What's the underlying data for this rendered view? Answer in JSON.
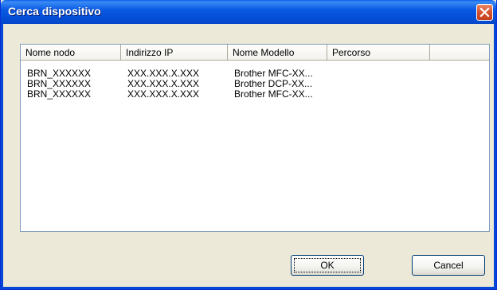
{
  "window": {
    "title": "Cerca dispositivo"
  },
  "table": {
    "columns": [
      "Nome nodo",
      "Indirizzo IP",
      "Nome Modello",
      "Percorso"
    ],
    "rows": [
      {
        "node": "BRN_XXXXXX",
        "ip": "XXX.XXX.X.XXX",
        "model": "Brother MFC-XX...",
        "path": ""
      },
      {
        "node": "BRN_XXXXXX",
        "ip": "XXX.XXX.X.XXX",
        "model": "Brother DCP-XX...",
        "path": ""
      },
      {
        "node": "BRN_XXXXXX",
        "ip": "XXX.XXX.X.XXX",
        "model": "Brother MFC-XX...",
        "path": ""
      }
    ]
  },
  "buttons": {
    "ok": "OK",
    "cancel": "Cancel"
  },
  "colors": {
    "titlebar": "#0550d8",
    "close": "#d6522e",
    "dialog_bg": "#ece9d8"
  }
}
